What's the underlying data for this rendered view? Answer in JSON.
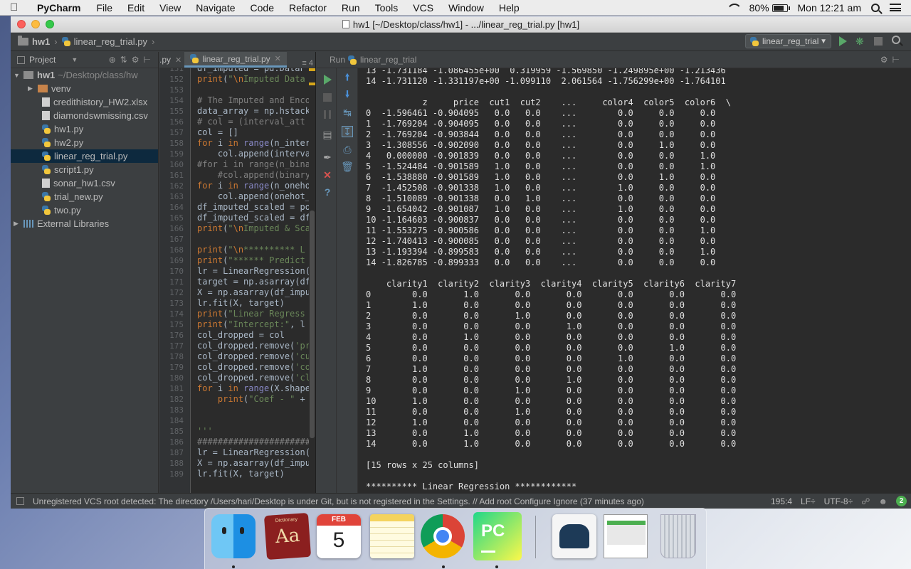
{
  "menubar": {
    "app": "PyCharm",
    "menus": [
      "File",
      "Edit",
      "View",
      "Navigate",
      "Code",
      "Refactor",
      "Run",
      "Tools",
      "VCS",
      "Window",
      "Help"
    ],
    "battery": "80%",
    "clock": "Mon 12:21 am"
  },
  "window": {
    "title": "hw1 [~/Desktop/class/hw1] - .../linear_reg_trial.py [hw1]"
  },
  "navbar": {
    "project": "hw1",
    "file": "linear_reg_trial.py",
    "run_config": "linear_reg_trial"
  },
  "project_panel": {
    "title": "Project",
    "root_name": "hw1",
    "root_path": "~/Desktop/class/hw",
    "items": [
      {
        "name": "venv",
        "kind": "folder"
      },
      {
        "name": "credithistory_HW2.xlsx",
        "kind": "file"
      },
      {
        "name": "diamondswmissing.csv",
        "kind": "file"
      },
      {
        "name": "hw1.py",
        "kind": "py"
      },
      {
        "name": "hw2.py",
        "kind": "py"
      },
      {
        "name": "linear_reg_trial.py",
        "kind": "py",
        "selected": true
      },
      {
        "name": "script1.py",
        "kind": "py"
      },
      {
        "name": "sonar_hw1.csv",
        "kind": "file"
      },
      {
        "name": "trial_new.py",
        "kind": "py"
      },
      {
        "name": "two.py",
        "kind": "py"
      }
    ],
    "external": "External Libraries"
  },
  "editor": {
    "tab_prev": ".py",
    "tab_active": "linear_reg_trial.py",
    "tab_more": "≡ 4",
    "first_line": 151,
    "lines": [
      "df_imputed = pd.DataF",
      "print(\"\\nImputed Data",
      "",
      "# The Imputed and Enco",
      "data_array = np.hstack",
      "# col = (interval_att",
      "col = []",
      "for i in range(n_inter",
      "    col.append(interva",
      "#for i in range(n_bina",
      "    #col.append(binary",
      "for i in range(n_oneho",
      "    col.append(onehot_",
      "df_imputed_scaled = po",
      "df_imputed_scaled = df",
      "print(\"\\nImputed & Sca",
      "",
      "print(\"\\n********** L",
      "print(\"****** Predict",
      "lr = LinearRegression(",
      "target = np.asarray(df",
      "X = np.asarray(df_impu",
      "lr.fit(X, target)",
      "print(\"Linear Regress",
      "print(\"Intercept:\", l",
      "col_dropped = col",
      "col_dropped.remove('pr",
      "col_dropped.remove('cu",
      "col_dropped.remove('co",
      "col_dropped.remove('cl",
      "for i in range(X.shape",
      "    print(\"Coef - \" +",
      "",
      "",
      "'''",
      "######################",
      "lr = LinearRegression(",
      "X = np.asarray(df_impu",
      "lr.fit(X, target)"
    ]
  },
  "run_panel": {
    "label": "Run",
    "config": "linear_reg_trial",
    "output": [
      "13 -1.731184 -1.086455e+00  0.319959 -1.569850 -1.249895e+00 -1.213436",
      "14 -1.731120 -1.331197e+00 -1.099110  2.061564 -1.756299e+00 -1.764101",
      "",
      "           z     price  cut1  cut2    ...     color4  color5  color6  \\",
      "0  -1.596461 -0.904095   0.0   0.0    ...        0.0     0.0     0.0",
      "1  -1.769204 -0.904095   0.0   0.0    ...        0.0     0.0     0.0",
      "2  -1.769204 -0.903844   0.0   0.0    ...        0.0     0.0     0.0",
      "3  -1.308556 -0.902090   0.0   0.0    ...        0.0     1.0     0.0",
      "4   0.000000 -0.901839   0.0   0.0    ...        0.0     0.0     1.0",
      "5  -1.524484 -0.901589   1.0   0.0    ...        0.0     0.0     1.0",
      "6  -1.538880 -0.901589   1.0   0.0    ...        0.0     1.0     0.0",
      "7  -1.452508 -0.901338   1.0   0.0    ...        1.0     0.0     0.0",
      "8  -1.510089 -0.901338   0.0   1.0    ...        0.0     0.0     0.0",
      "9  -1.654042 -0.901087   1.0   0.0    ...        1.0     0.0     0.0",
      "10 -1.164603 -0.900837   0.0   0.0    ...        0.0     0.0     0.0",
      "11 -1.553275 -0.900586   0.0   0.0    ...        0.0     0.0     1.0",
      "12 -1.740413 -0.900085   0.0   0.0    ...        0.0     0.0     0.0",
      "13 -1.193394 -0.899583   0.0   0.0    ...        0.0     0.0     1.0",
      "14 -1.826785 -0.899333   0.0   0.0    ...        0.0     0.0     0.0",
      "",
      "    clarity1  clarity2  clarity3  clarity4  clarity5  clarity6  clarity7",
      "0        0.0       1.0       0.0       0.0       0.0       0.0       0.0",
      "1        1.0       0.0       0.0       0.0       0.0       0.0       0.0",
      "2        0.0       0.0       1.0       0.0       0.0       0.0       0.0",
      "3        0.0       0.0       0.0       1.0       0.0       0.0       0.0",
      "4        0.0       1.0       0.0       0.0       0.0       0.0       0.0",
      "5        0.0       0.0       0.0       0.0       0.0       1.0       0.0",
      "6        0.0       0.0       0.0       0.0       1.0       0.0       0.0",
      "7        1.0       0.0       0.0       0.0       0.0       0.0       0.0",
      "8        0.0       0.0       0.0       1.0       0.0       0.0       0.0",
      "9        0.0       0.0       1.0       0.0       0.0       0.0       0.0",
      "10       1.0       0.0       0.0       0.0       0.0       0.0       0.0",
      "11       0.0       0.0       1.0       0.0       0.0       0.0       0.0",
      "12       1.0       0.0       0.0       0.0       0.0       0.0       0.0",
      "13       0.0       1.0       0.0       0.0       0.0       0.0       0.0",
      "14       0.0       1.0       0.0       0.0       0.0       0.0       0.0",
      "",
      "[15 rows x 25 columns]",
      "",
      "********** Linear Regression ************"
    ]
  },
  "statusbar": {
    "message": "Unregistered VCS root detected: The directory /Users/hari/Desktop is under Git, but is not registered in the Settings. // Add root  Configure  Ignore (37 minutes ago)",
    "position": "195:4",
    "line_sep": "LF÷",
    "encoding": "UTF-8÷",
    "events": "2"
  },
  "dock": {
    "dictionary_label": "Dictionary",
    "dictionary_glyph": "Aa",
    "calendar_month": "FEB",
    "calendar_day": "5",
    "pycharm_glyph": "PC"
  },
  "colors": {
    "accent": "#6897bb",
    "run_green": "#59a869",
    "selection": "#0d293e"
  }
}
